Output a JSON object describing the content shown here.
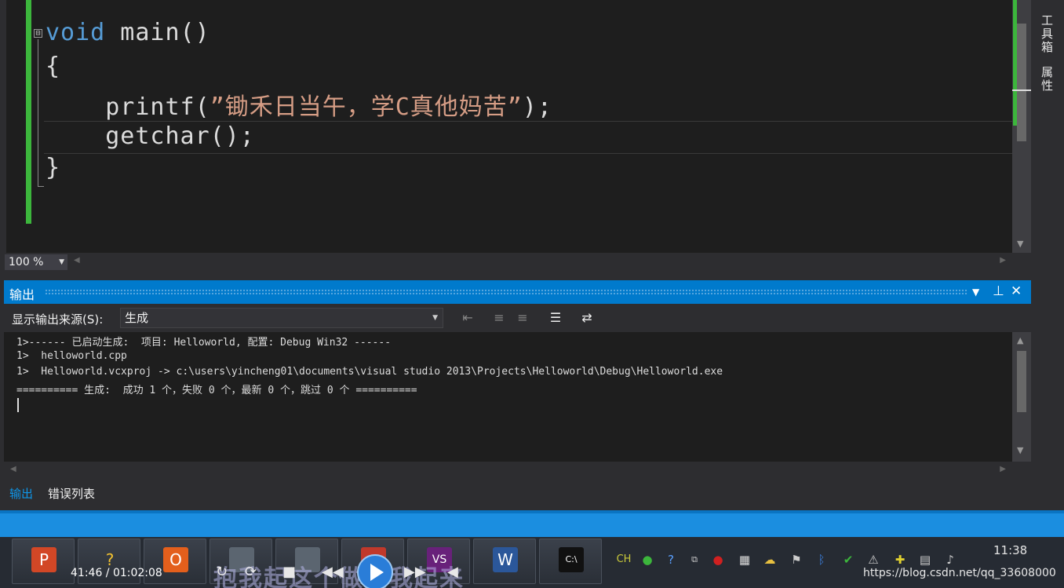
{
  "editor": {
    "code": {
      "line1_kw": "void",
      "line1_rest": " main()",
      "line2": "{",
      "line3_fn": "    printf(",
      "line3_str": "”锄禾日当午，学C真他妈苦”",
      "line3_end": ");",
      "line4": "    getchar();",
      "line5": "}"
    },
    "zoom": "100 %",
    "fold_symbol": "⊟"
  },
  "right_dock": {
    "toolbox": "工具箱",
    "properties": "属性"
  },
  "output": {
    "title": "输出",
    "source_label": "显示输出来源(S):",
    "source_value": "生成",
    "lines": [
      "1>------ 已启动生成:  项目: Helloworld, 配置: Debug Win32 ------",
      "1>  helloworld.cpp",
      "1>  Helloworld.vcxproj -> c:\\users\\yincheng01\\documents\\visual studio 2013\\Projects\\Helloworld\\Debug\\Helloworld.exe",
      "========== 生成:  成功 1 个，失败 0 个，最新 0 个，跳过 0 个 =========="
    ]
  },
  "bottom_tabs": {
    "output": "输出",
    "error_list": "错误列表"
  },
  "taskbar": {
    "apps": [
      {
        "icon": "powerpoint-icon",
        "label": "P",
        "color": "#d24726"
      },
      {
        "icon": "help-icon",
        "label": "?",
        "color": "#c9a227"
      },
      {
        "icon": "office-icon",
        "label": "O",
        "color": "#e35f1c"
      },
      {
        "icon": "app-icon",
        "label": "",
        "color": "#5b6570"
      },
      {
        "icon": "app-icon",
        "label": "",
        "color": "#5b6570"
      },
      {
        "icon": "app-icon",
        "label": "",
        "color": "#c0392b"
      },
      {
        "icon": "visual-studio-icon",
        "label": "VS",
        "color": "#68217a"
      },
      {
        "icon": "word-icon",
        "label": "W",
        "color": "#2b579a"
      },
      {
        "icon": "console-icon",
        "label": "C:\\",
        "color": "#111111"
      }
    ],
    "ime": "CH",
    "clock": "11:38",
    "url": "https://blog.csdn.net/qq_33608000",
    "player_time": "41:46 / 01:02:08",
    "subtitle": "抱我起这个做知我起来"
  }
}
